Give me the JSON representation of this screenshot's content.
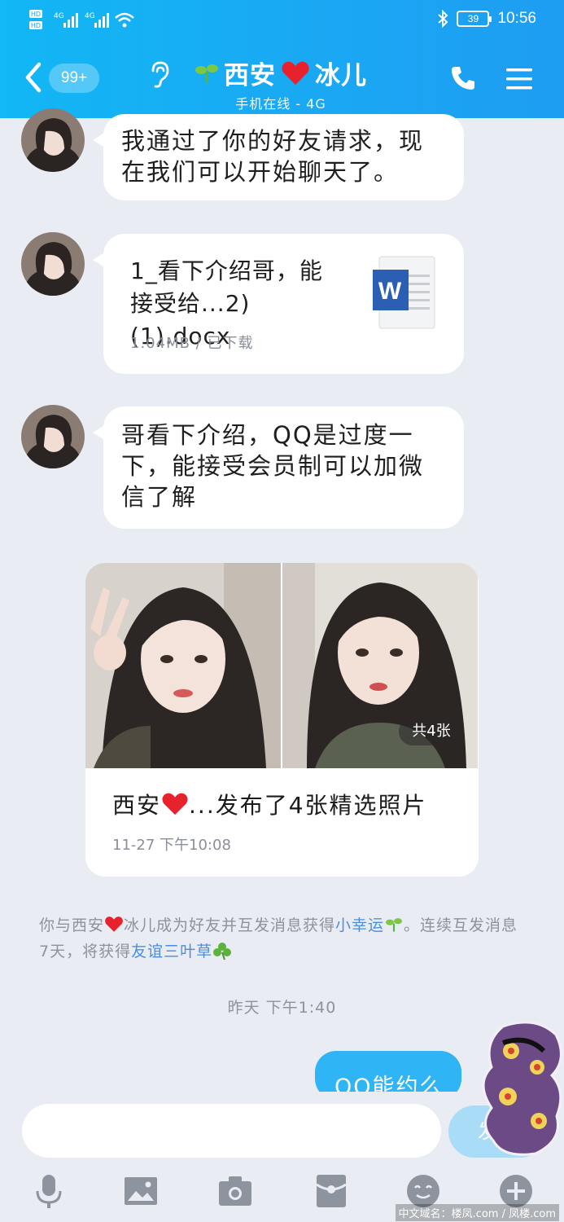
{
  "status": {
    "time": "10:56",
    "battery": "39",
    "hd1": "HD",
    "hd2": "HD",
    "net1": "4G",
    "net2": "4G"
  },
  "header": {
    "unread": "99+",
    "name_part1": "西安",
    "name_part2": "冰儿",
    "subtitle": "手机在线 - 4G"
  },
  "messages": {
    "m1": "我通过了你的好友请求，现在我们可以开始聊天了。",
    "file_name": "1_看下介绍哥，能接受给...2)(1).docx",
    "file_meta": "1.04MB / 已下载",
    "m3": "哥看下介绍，QQ是过度一下，能接受会员制可以加微信了解",
    "card_title_a": "西安",
    "card_title_b": "...发布了4张精选照片",
    "card_time": "11-27  下午10:08",
    "photo_count": "共4张"
  },
  "system": {
    "p1": "你与西安",
    "p2": "冰儿成为好友并互发消息获得",
    "link1": "小幸运",
    "p3": "。连续互发消息7天，将获得",
    "link2": "友谊三叶草"
  },
  "timestamp": "昨天  下午1:40",
  "outgoing": "QQ能约么",
  "input": {
    "send_label": "发送",
    "placeholder": ""
  },
  "watermark": "中文域名：楼凤.com / 凤楼.com",
  "colors": {
    "header": "#12b7f5",
    "bubble_out": "#2fb4f6",
    "link": "#4a8ee0",
    "background": "#e9ecf3"
  }
}
